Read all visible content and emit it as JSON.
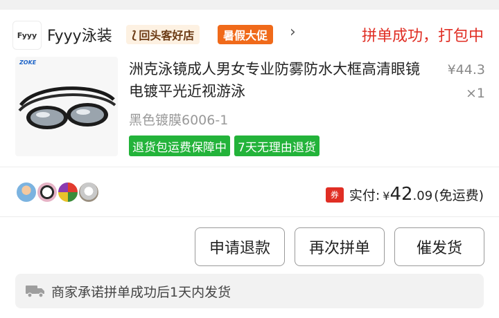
{
  "shop": {
    "logo_text": "Fyyy",
    "name": "Fyyy泳装",
    "badge_return": "回头客好店",
    "badge_summer": "暑假大促",
    "chevron": "›"
  },
  "order": {
    "status": "拼单成功，打包中"
  },
  "product": {
    "image_brand": "ZOKE",
    "title": "洲克泳镜成人男女专业防雾防水大框高清眼镜电镀平光近视游泳",
    "price": "¥44.3",
    "quantity": "×1",
    "variant": "黑色镀膜6006-1",
    "tags": [
      "退货包运费保障中",
      "7天无理由退货"
    ]
  },
  "payment": {
    "coupon_icon_text": "券",
    "label": "实付:",
    "currency": "¥",
    "amount_int": "42",
    "amount_dec": ".09",
    "note": "(免运费)"
  },
  "buttons": {
    "refund": "申请退款",
    "regroup": "再次拼单",
    "urge": "催发货"
  },
  "notice": {
    "icon": "truck-icon",
    "text": "商家承诺拼单成功后1天内发货"
  },
  "colors": {
    "accent_red": "#e02e24",
    "tag_green": "#23b33a",
    "summer_orange": "#f06a1a"
  }
}
